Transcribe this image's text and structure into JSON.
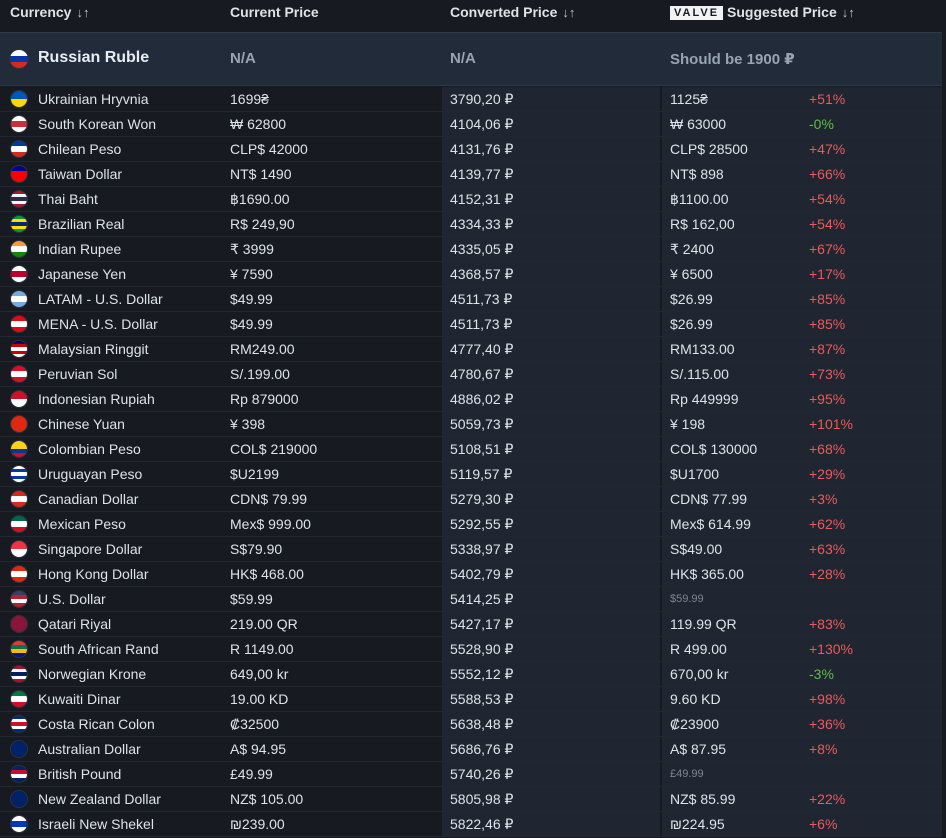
{
  "header": {
    "currency": "Currency",
    "current_price": "Current Price",
    "converted_price": "Converted Price",
    "valve_logo": "VALVE",
    "suggested_price": "Suggested Price",
    "sort_glyph": "↓↑"
  },
  "reference": {
    "name": "Russian Ruble",
    "current": "N/A",
    "converted": "N/A",
    "suggested": "Should be 1900 ₽",
    "flag_colors": [
      "#ffffff",
      "#0039a6",
      "#d52b1e"
    ]
  },
  "colors": {
    "background": "#171a21",
    "positive_diff": "#ea5a5a",
    "negative_diff": "#5fbf45"
  },
  "rows": [
    {
      "name": "Ukrainian Hryvnia",
      "current": "1699₴",
      "converted": "3790,20 ₽",
      "suggested": "1125₴",
      "diff": "+51%",
      "sign": "pos",
      "flag": [
        "#0057b7",
        "#ffd700"
      ]
    },
    {
      "name": "South Korean Won",
      "current": "₩ 62800",
      "converted": "4104,06 ₽",
      "suggested": "₩ 63000",
      "diff": "-0%",
      "sign": "neg",
      "flag": [
        "#ffffff",
        "#cd2e3a",
        "#ffffff"
      ]
    },
    {
      "name": "Chilean Peso",
      "current": "CLP$ 42000",
      "converted": "4131,76 ₽",
      "suggested": "CLP$ 28500",
      "diff": "+47%",
      "sign": "pos",
      "flag": [
        "#0039a6",
        "#ffffff",
        "#d52b1e"
      ]
    },
    {
      "name": "Taiwan Dollar",
      "current": "NT$ 1490",
      "converted": "4139,77 ₽",
      "suggested": "NT$ 898",
      "diff": "+66%",
      "sign": "pos",
      "flag": [
        "#000095",
        "#fe0000",
        "#fe0000"
      ]
    },
    {
      "name": "Thai Baht",
      "current": "฿1690.00",
      "converted": "4152,31 ₽",
      "suggested": "฿1100.00",
      "diff": "+54%",
      "sign": "pos",
      "flag": [
        "#a51931",
        "#f4f5f8",
        "#2d2a4a",
        "#f4f5f8",
        "#a51931"
      ]
    },
    {
      "name": "Brazilian Real",
      "current": "R$ 249,90",
      "converted": "4334,33 ₽",
      "suggested": "R$ 162,00",
      "diff": "+54%",
      "sign": "pos",
      "flag": [
        "#009c3b",
        "#ffdf00",
        "#002776",
        "#ffdf00",
        "#009c3b"
      ]
    },
    {
      "name": "Indian Rupee",
      "current": "₹ 3999",
      "converted": "4335,05 ₽",
      "suggested": "₹ 2400",
      "diff": "+67%",
      "sign": "pos",
      "flag": [
        "#ff9933",
        "#ffffff",
        "#138808"
      ]
    },
    {
      "name": "Japanese Yen",
      "current": "¥ 7590",
      "converted": "4368,57 ₽",
      "suggested": "¥ 6500",
      "diff": "+17%",
      "sign": "pos",
      "flag": [
        "#ffffff",
        "#bc002d",
        "#ffffff"
      ]
    },
    {
      "name": "LATAM - U.S. Dollar",
      "current": "$49.99",
      "converted": "4511,73 ₽",
      "suggested": "$26.99",
      "diff": "+85%",
      "sign": "pos",
      "flag": [
        "#74acdf",
        "#ffffff",
        "#74acdf"
      ]
    },
    {
      "name": "MENA - U.S. Dollar",
      "current": "$49.99",
      "converted": "4511,73 ₽",
      "suggested": "$26.99",
      "diff": "+85%",
      "sign": "pos",
      "flag": [
        "#e30a17",
        "#ffffff",
        "#e30a17"
      ]
    },
    {
      "name": "Malaysian Ringgit",
      "current": "RM249.00",
      "converted": "4777,40 ₽",
      "suggested": "RM133.00",
      "diff": "+87%",
      "sign": "pos",
      "flag": [
        "#010066",
        "#cc0001",
        "#ffffff",
        "#cc0001",
        "#ffffff"
      ]
    },
    {
      "name": "Peruvian Sol",
      "current": "S/.199.00",
      "converted": "4780,67 ₽",
      "suggested": "S/.115.00",
      "diff": "+73%",
      "sign": "pos",
      "flag": [
        "#d91023",
        "#ffffff",
        "#d91023"
      ]
    },
    {
      "name": "Indonesian Rupiah",
      "current": "Rp 879000",
      "converted": "4886,02 ₽",
      "suggested": "Rp 449999",
      "diff": "+95%",
      "sign": "pos",
      "flag": [
        "#ce1126",
        "#ffffff"
      ]
    },
    {
      "name": "Chinese Yuan",
      "current": "¥ 398",
      "converted": "5059,73 ₽",
      "suggested": "¥ 198",
      "diff": "+101%",
      "sign": "pos",
      "flag": [
        "#de2910",
        "#de2910"
      ]
    },
    {
      "name": "Colombian Peso",
      "current": "COL$ 219000",
      "converted": "5108,51 ₽",
      "suggested": "COL$ 130000",
      "diff": "+68%",
      "sign": "pos",
      "flag": [
        "#fcd116",
        "#fcd116",
        "#003893",
        "#ce1126"
      ]
    },
    {
      "name": "Uruguayan Peso",
      "current": "$U2199",
      "converted": "5119,57 ₽",
      "suggested": "$U1700",
      "diff": "+29%",
      "sign": "pos",
      "flag": [
        "#ffffff",
        "#0038a8",
        "#ffffff",
        "#0038a8",
        "#ffffff"
      ]
    },
    {
      "name": "Canadian Dollar",
      "current": "CDN$ 79.99",
      "converted": "5279,30 ₽",
      "suggested": "CDN$ 77.99",
      "diff": "+3%",
      "sign": "pos",
      "flag": [
        "#d52b1e",
        "#ffffff",
        "#d52b1e"
      ]
    },
    {
      "name": "Mexican Peso",
      "current": "Mex$ 999.00",
      "converted": "5292,55 ₽",
      "suggested": "Mex$ 614.99",
      "diff": "+62%",
      "sign": "pos",
      "flag": [
        "#006847",
        "#ffffff",
        "#ce1126"
      ]
    },
    {
      "name": "Singapore Dollar",
      "current": "S$79.90",
      "converted": "5338,97 ₽",
      "suggested": "S$49.00",
      "diff": "+63%",
      "sign": "pos",
      "flag": [
        "#ef3340",
        "#ffffff"
      ]
    },
    {
      "name": "Hong Kong Dollar",
      "current": "HK$ 468.00",
      "converted": "5402,79 ₽",
      "suggested": "HK$ 365.00",
      "diff": "+28%",
      "sign": "pos",
      "flag": [
        "#de2910",
        "#ffffff",
        "#de2910"
      ]
    },
    {
      "name": "U.S. Dollar",
      "current": "$59.99",
      "converted": "5414,25 ₽",
      "suggested": "$59.99",
      "diff": "",
      "sign": "none",
      "flag": [
        "#3c3b6e",
        "#b22234",
        "#ffffff",
        "#b22234"
      ]
    },
    {
      "name": "Qatari Riyal",
      "current": "219.00 QR",
      "converted": "5427,17 ₽",
      "suggested": "119.99 QR",
      "diff": "+83%",
      "sign": "pos",
      "flag": [
        "#8a1538",
        "#8a1538"
      ]
    },
    {
      "name": "South African Rand",
      "current": "R 1149.00",
      "converted": "5528,90 ₽",
      "suggested": "R 499.00",
      "diff": "+130%",
      "sign": "pos",
      "flag": [
        "#e03c31",
        "#007749",
        "#ffb612",
        "#001489"
      ]
    },
    {
      "name": "Norwegian Krone",
      "current": "649,00 kr",
      "converted": "5552,12 ₽",
      "suggested": "670,00 kr",
      "diff": "-3%",
      "sign": "neg",
      "flag": [
        "#ba0c2f",
        "#ffffff",
        "#00205b",
        "#ffffff",
        "#ba0c2f"
      ]
    },
    {
      "name": "Kuwaiti Dinar",
      "current": "19.00 KD",
      "converted": "5588,53 ₽",
      "suggested": "9.60 KD",
      "diff": "+98%",
      "sign": "pos",
      "flag": [
        "#007a3d",
        "#ffffff",
        "#ce1126"
      ]
    },
    {
      "name": "Costa Rican Colon",
      "current": "₡32500",
      "converted": "5638,48 ₽",
      "suggested": "₡23900",
      "diff": "+36%",
      "sign": "pos",
      "flag": [
        "#002b7f",
        "#ffffff",
        "#ce1126",
        "#ffffff",
        "#002b7f"
      ]
    },
    {
      "name": "Australian Dollar",
      "current": "A$ 94.95",
      "converted": "5686,76 ₽",
      "suggested": "A$ 87.95",
      "diff": "+8%",
      "sign": "pos",
      "flag": [
        "#012169",
        "#012169"
      ]
    },
    {
      "name": "British Pound",
      "current": "£49.99",
      "converted": "5740,26 ₽",
      "suggested": "£49.99",
      "diff": "",
      "sign": "none",
      "flag": [
        "#012169",
        "#c8102e",
        "#ffffff",
        "#012169"
      ]
    },
    {
      "name": "New Zealand Dollar",
      "current": "NZ$ 105.00",
      "converted": "5805,98 ₽",
      "suggested": "NZ$ 85.99",
      "diff": "+22%",
      "sign": "pos",
      "flag": [
        "#012169",
        "#012169"
      ]
    },
    {
      "name": "Israeli New Shekel",
      "current": "₪239.00",
      "converted": "5822,46 ₽",
      "suggested": "₪224.95",
      "diff": "+6%",
      "sign": "pos",
      "flag": [
        "#ffffff",
        "#0038b8",
        "#ffffff"
      ]
    }
  ]
}
